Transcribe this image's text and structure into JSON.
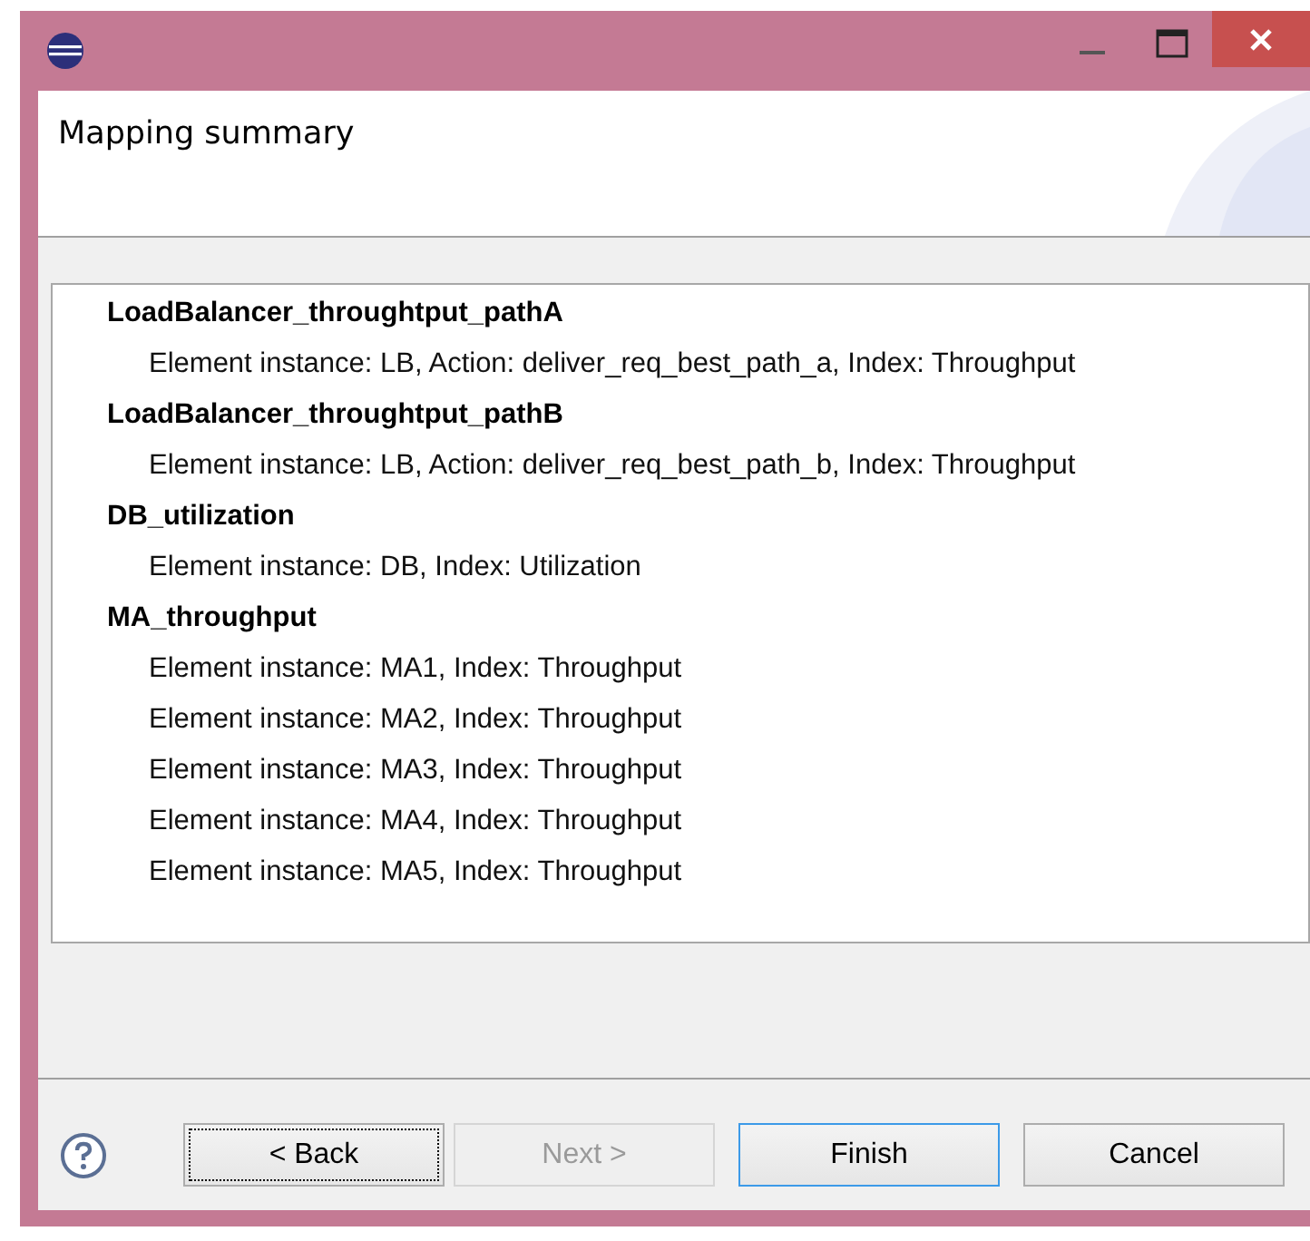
{
  "header": {
    "title": "Mapping summary"
  },
  "summary_tree": [
    {
      "label": "LoadBalancer_throughtput_pathA",
      "children": [
        {
          "label": "Element instance: LB, Action: deliver_req_best_path_a, Index: Throughput"
        }
      ]
    },
    {
      "label": "LoadBalancer_throughtput_pathB",
      "children": [
        {
          "label": "Element instance: LB, Action: deliver_req_best_path_b, Index: Throughput"
        }
      ]
    },
    {
      "label": "DB_utilization",
      "children": [
        {
          "label": "Element instance: DB, Index: Utilization"
        }
      ]
    },
    {
      "label": "MA_throughput",
      "children": [
        {
          "label": "Element instance: MA1, Index: Throughput"
        },
        {
          "label": "Element instance: MA2, Index: Throughput"
        },
        {
          "label": "Element instance: MA3, Index: Throughput"
        },
        {
          "label": "Element instance: MA4, Index: Throughput"
        },
        {
          "label": "Element instance: MA5, Index: Throughput"
        }
      ]
    }
  ],
  "buttons": [
    {
      "label": "< Back",
      "disabled": false,
      "focused": true,
      "default": false
    },
    {
      "label": "Next >",
      "disabled": true,
      "focused": false,
      "default": false
    },
    {
      "label": "Finish",
      "disabled": false,
      "focused": false,
      "default": true
    },
    {
      "label": "Cancel",
      "disabled": false,
      "focused": false,
      "default": false
    }
  ]
}
